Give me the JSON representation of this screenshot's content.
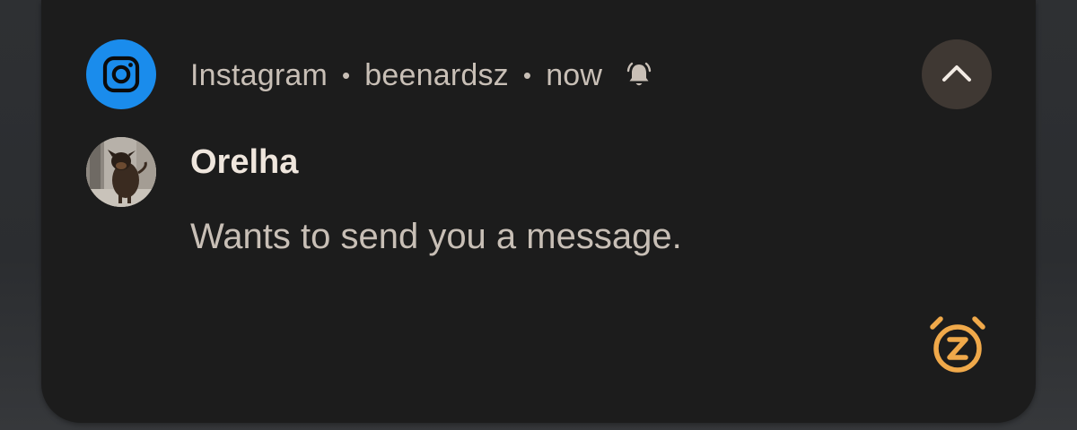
{
  "notification": {
    "app_name": "Instagram",
    "account": "beenardsz",
    "time": "now",
    "separator": "•",
    "sender": "Orelha",
    "message": "Wants to send you a message."
  },
  "icons": {
    "app": "instagram-icon",
    "alert": "bell-ringing-icon",
    "collapse": "chevron-up-icon",
    "snooze": "snooze-alarm-icon",
    "avatar": "dog-photo-avatar"
  },
  "colors": {
    "card_background": "#1c1c1c",
    "app_icon_background": "#1a8cec",
    "primary_text": "#efe6dd",
    "secondary_text": "#c8bfb6",
    "collapse_button_background": "#3f3833",
    "snooze_accent": "#f0a94a"
  }
}
